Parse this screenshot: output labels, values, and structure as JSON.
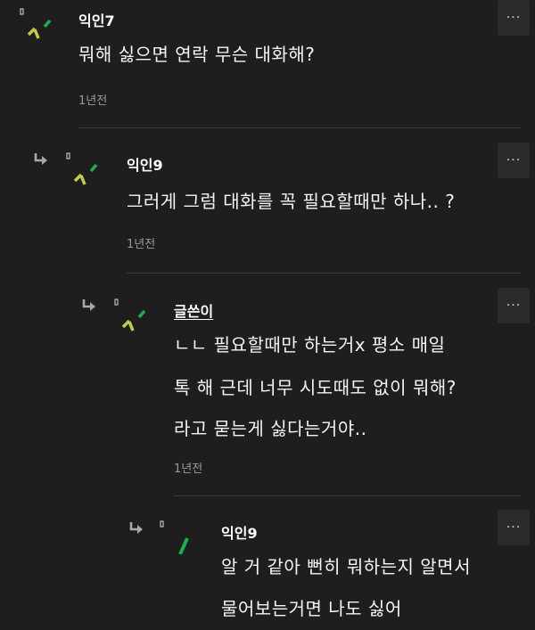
{
  "comments": [
    {
      "author": "익인7",
      "lines": [
        "뭐해 싫으면 연락 무슨 대화해?"
      ],
      "time": "1년전",
      "is_reply": false,
      "is_op": false
    },
    {
      "author": "익인9",
      "lines": [
        "그러게 그럼 대화를 꼭 필요할때만 하나.. ?"
      ],
      "time": "1년전",
      "is_reply": true,
      "is_op": false
    },
    {
      "author": "글쓴이",
      "lines": [
        "ㄴㄴ 필요할때만 하는거x 평소 매일",
        "톡 해 근데 너무 시도때도 없이 뭐해?",
        "라고 묻는게 싫다는거야.."
      ],
      "time": "1년전",
      "is_reply": true,
      "is_op": true
    },
    {
      "author": "익인9",
      "lines": [
        "알 거 같아 뻔히 뭐하는지 알면서",
        "물어보는거면 나도 싫어"
      ],
      "time": "",
      "is_reply": true,
      "is_op": false
    }
  ],
  "more_button_label": "···",
  "icons": {
    "reply": "reply-arrow-icon",
    "more": "more-dots-icon",
    "avatar": "avatar-icon"
  },
  "colors": {
    "background": "#1e1e1e",
    "avatar_yellow": "#c6c84a",
    "avatar_green": "#1fae4a",
    "avatar_tag": "#bdbdbd"
  }
}
